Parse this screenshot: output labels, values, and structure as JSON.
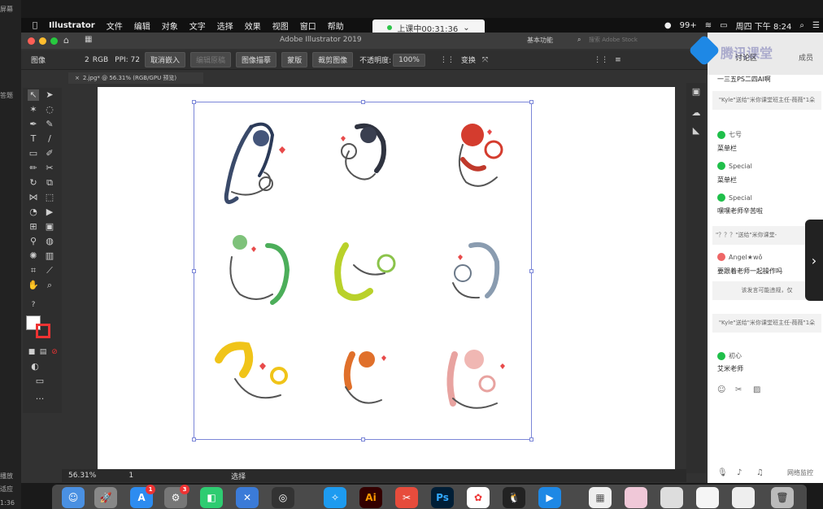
{
  "outer_left": {
    "label_top": "屏幕",
    "label_mid": "答题",
    "label_bottom1": "播放",
    "label_bottom2": "适应",
    "time": "1:36"
  },
  "menubar": {
    "app": "Illustrator",
    "items": [
      "文件",
      "编辑",
      "对象",
      "文字",
      "选择",
      "效果",
      "视图",
      "窗口",
      "帮助"
    ],
    "right": {
      "battery_count": "99+",
      "clock": "周四 下午 8:24"
    }
  },
  "live": {
    "status": "上课中00:31:36",
    "caret": "⌄"
  },
  "ai": {
    "window_title": "Adobe Illustrator 2019",
    "workspace": "基本功能",
    "search_placeholder": "搜索 Adobe Stock",
    "control": {
      "selection_type": "图像",
      "color_count": "2",
      "color_mode": "RGB",
      "ppi": "PPI: 72",
      "unembed": "取消嵌入",
      "edit_original": "编辑原稿",
      "image_trace": "图像描摹",
      "mask": "蒙版",
      "crop_image": "裁剪图像",
      "opacity_label": "不透明度:",
      "opacity_value": "100%",
      "transform": "变换"
    },
    "doc_tab": "2.jpg* @ 56.31% (RGB/GPU 预览)",
    "status": {
      "zoom": "56.31%",
      "artboard": "1",
      "tool": "选择"
    }
  },
  "chat": {
    "tab_label": "讨论区",
    "tab2_label": "成员",
    "brand": "腾讯课堂",
    "messages": [
      {
        "type": "text",
        "text": "一三五PS二四AI啊"
      },
      {
        "type": "gift",
        "text": "\"Kyle\"送给\"米你课堂班主任-薇薇\"1朵"
      },
      {
        "type": "user",
        "name": "七号"
      },
      {
        "type": "text",
        "text": "菜单栏"
      },
      {
        "type": "user",
        "name": "Special"
      },
      {
        "type": "text",
        "text": "菜单栏"
      },
      {
        "type": "user",
        "name": "Special"
      },
      {
        "type": "text",
        "text": "嘿嘿老师辛苦啦"
      },
      {
        "type": "gift",
        "text": "\"？？？\"送给\"米你课堂-"
      },
      {
        "type": "user",
        "name": "Angel★wǒ"
      },
      {
        "type": "text",
        "text": "要跟着老师一起操作吗"
      },
      {
        "type": "gift",
        "text": "该发言可能违规，仅"
      },
      {
        "type": "gift",
        "text": "\"Kyle\"送给\"米你课堂班主任-薇薇\"1朵"
      },
      {
        "type": "user",
        "name": "初心"
      },
      {
        "type": "text",
        "text": "艾米老师"
      }
    ],
    "footer": "网络监控"
  },
  "dock": {
    "appstore_badge": "1",
    "prefs_badge": "3",
    "ai_label": "Ai",
    "ps_label": "Ps"
  },
  "colors": {
    "accent_green": "#1fbf4a",
    "selection_blue": "#7b86d8",
    "ai_orange": "#ff9a00"
  }
}
